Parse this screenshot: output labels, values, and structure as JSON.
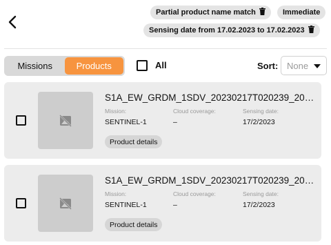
{
  "header": {
    "back_icon": "chevron-left-icon",
    "filters": [
      {
        "label": "Partial product name match",
        "icon": "trash-icon"
      },
      {
        "label": "Immediate"
      },
      {
        "label": "Sensing date from 17.02.2023 to 17.02.2023",
        "icon": "trash-icon"
      }
    ]
  },
  "toolbar": {
    "tabs": [
      "Missions",
      "Products"
    ],
    "active_tab": "Products",
    "select_all_label": "All",
    "sort_label": "Sort:",
    "sort_value": "None"
  },
  "products": [
    {
      "name": "S1A_EW_GRDM_1SDV_20230217T020239_202...",
      "mission_label": "Mission:",
      "mission": "SENTINEL-1",
      "cloud_label": "Cloud coverage:",
      "cloud": "–",
      "sensing_label": "Sensing date:",
      "sensing": "17/2/2023",
      "details_label": "Product details"
    },
    {
      "name": "S1A_EW_GRDM_1SDV_20230217T020239_202...",
      "mission_label": "Mission:",
      "mission": "SENTINEL-1",
      "cloud_label": "Cloud coverage:",
      "cloud": "–",
      "sensing_label": "Sensing date:",
      "sensing": "17/2/2023",
      "details_label": "Product details"
    }
  ],
  "colors": {
    "accent": "#f7943f",
    "card_bg": "#ececec",
    "chip_bg": "#e4e4e4"
  }
}
